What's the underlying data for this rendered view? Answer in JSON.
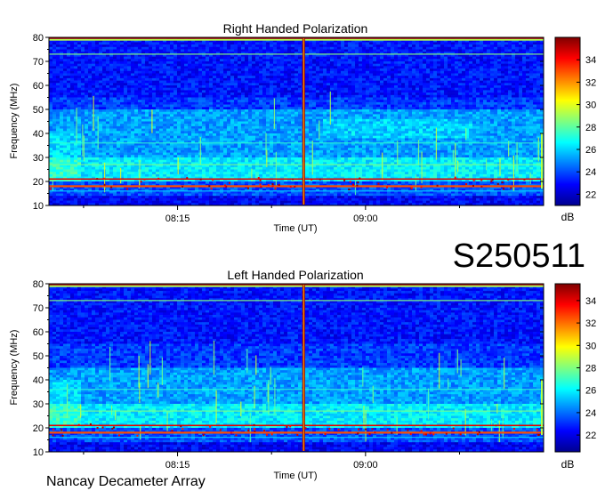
{
  "station_code": "S250511",
  "footer": "Nancay Decameter Array",
  "chart_data": [
    {
      "type": "heatmap",
      "title": "Right Handed Polarization",
      "xlabel": "Time (UT)",
      "ylabel": "Frequency (MHz)",
      "xticks": [
        "08:15",
        "09:00"
      ],
      "yticks": [
        10,
        20,
        30,
        40,
        50,
        60,
        70,
        80
      ],
      "ylim": [
        10,
        80
      ],
      "colorbar": {
        "label": "dB",
        "ticks": [
          22,
          24,
          26,
          28,
          30,
          32,
          34
        ],
        "range": [
          21,
          36
        ]
      },
      "colormap": "jet",
      "features": {
        "strong_lines_mhz": [
          18,
          21
        ],
        "weak_lines_mhz": [
          73,
          36
        ],
        "top_band_mhz": 79,
        "event_time_frac": 0.515,
        "enhanced_region_mhz": [
          20,
          50
        ]
      }
    },
    {
      "type": "heatmap",
      "title": "Left Handed Polarization",
      "xlabel": "Time (UT)",
      "ylabel": "Frequency (MHz)",
      "xticks": [
        "08:15",
        "09:00"
      ],
      "yticks": [
        10,
        20,
        30,
        40,
        50,
        60,
        70,
        80
      ],
      "ylim": [
        10,
        80
      ],
      "colorbar": {
        "label": "dB",
        "ticks": [
          22,
          24,
          26,
          28,
          30,
          32,
          34
        ],
        "range": [
          20.5,
          35.5
        ]
      },
      "colormap": "jet",
      "features": {
        "strong_lines_mhz": [
          18,
          21
        ],
        "weak_lines_mhz": [
          73,
          36
        ],
        "top_band_mhz": 79,
        "event_time_frac": 0.515,
        "enhanced_region_mhz": [
          20,
          45
        ]
      }
    }
  ]
}
